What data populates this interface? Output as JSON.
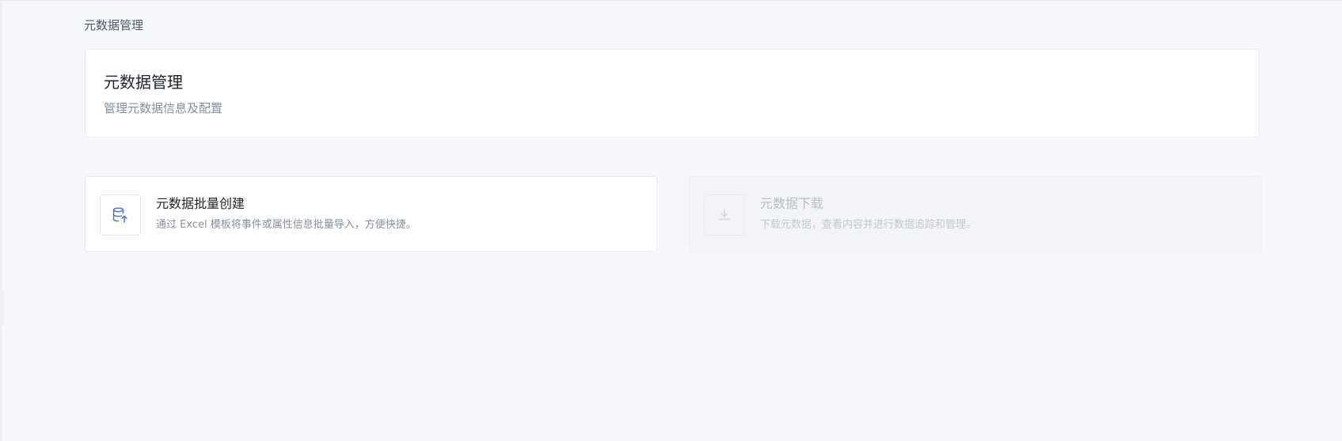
{
  "breadcrumb": {
    "current": "元数据管理"
  },
  "header": {
    "title": "元数据管理",
    "subtitle": "管理元数据信息及配置"
  },
  "cards": {
    "bulk_create": {
      "title": "元数据批量创建",
      "description": "通过 Excel 模板将事件或属性信息批量导入，方便快捷。",
      "icon": "database-upload-icon",
      "icon_color": "#3b6cf5",
      "enabled": true
    },
    "download": {
      "title": "元数据下载",
      "description": "下载元数据，查看内容并进行数据追踪和管理。",
      "icon": "download-icon",
      "icon_color": "#d3d6dc",
      "enabled": false
    }
  },
  "colors": {
    "page_background": "#f6f7fb",
    "card_background": "#ffffff",
    "disabled_card_background": "#f3f4f8",
    "primary_text": "#1f2329",
    "secondary_text": "#86909c",
    "accent": "#3b6cf5"
  }
}
